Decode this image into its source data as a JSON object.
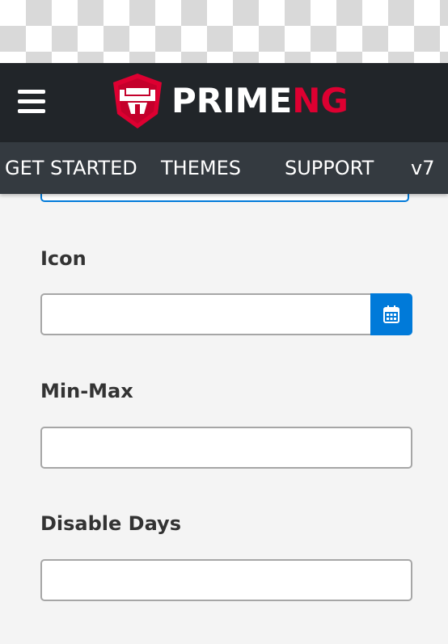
{
  "header": {
    "logo": {
      "text_prime": "PRIME",
      "text_ng": "NG",
      "brand_white": "#ffffff",
      "brand_red": "#dd0031"
    },
    "background": "#212529"
  },
  "nav": {
    "background": "#343a40",
    "items": [
      {
        "label": "GET STARTED"
      },
      {
        "label": "THEMES"
      },
      {
        "label": "SUPPORT"
      },
      {
        "label": "v7"
      }
    ]
  },
  "form": {
    "fields": [
      {
        "label": "Icon",
        "value": "",
        "button_icon": "calendar-icon"
      },
      {
        "label": "Min-Max",
        "value": ""
      },
      {
        "label": "Disable Days",
        "value": ""
      }
    ],
    "accent": "#007ad9"
  }
}
